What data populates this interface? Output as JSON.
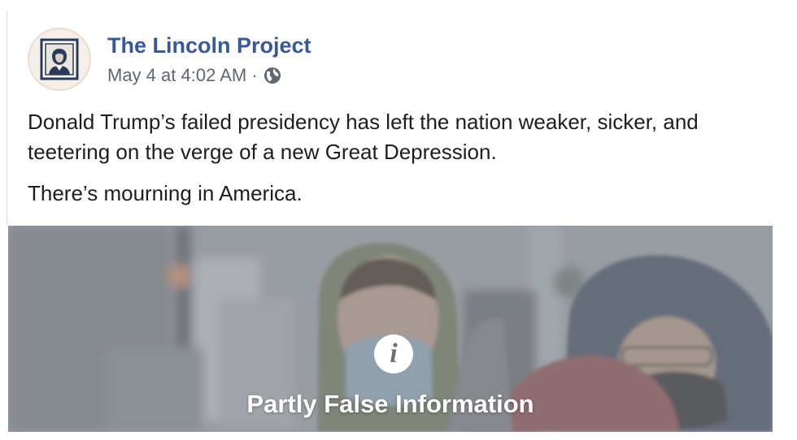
{
  "post": {
    "page_name": "The Lincoln Project",
    "timestamp": "May 4 at 4:02 AM",
    "separator": "·",
    "privacy_icon": "globe-icon",
    "paragraphs": [
      "Donald Trump’s failed presidency has left the nation weaker, sicker, and teetering on the verge of a new Great Depression.",
      "There’s mourning in America."
    ]
  },
  "media": {
    "warning_icon": "info-icon",
    "warning_glyph": "i",
    "warning_label": "Partly False Information"
  },
  "colors": {
    "page_name": "#385898",
    "meta_text": "#606770",
    "body_text": "#1c1e21"
  }
}
